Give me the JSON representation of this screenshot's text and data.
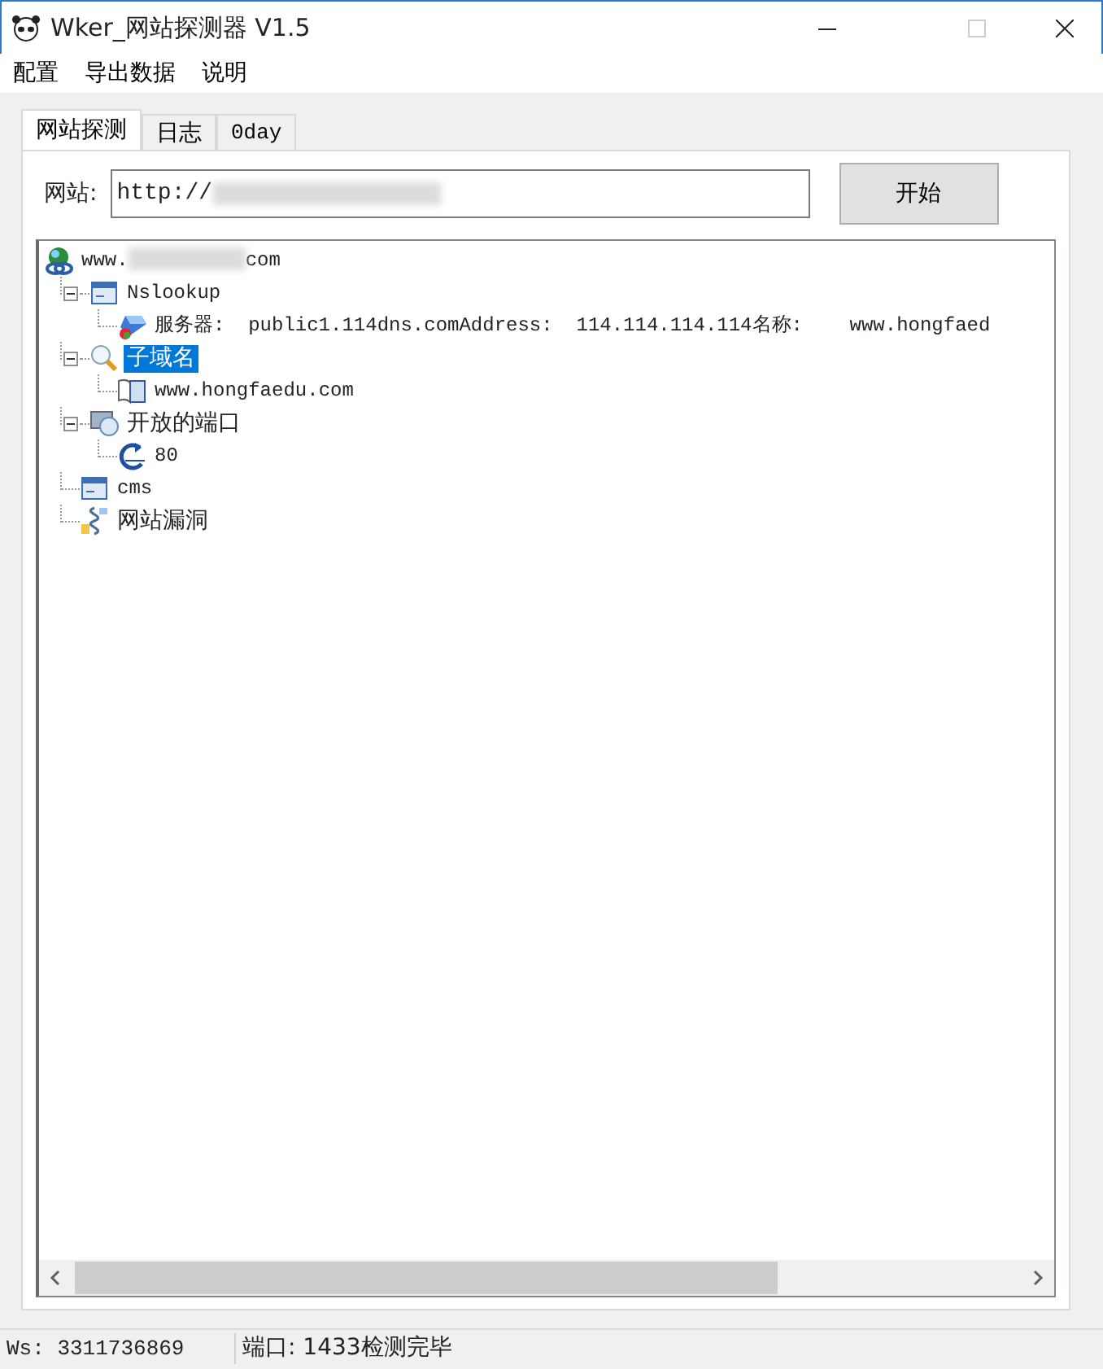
{
  "window": {
    "title": "Wker_网站探测器 V1.5"
  },
  "menu": [
    "配置",
    "导出数据",
    "说明"
  ],
  "tabs": [
    {
      "label": "网站探测",
      "selected": true
    },
    {
      "label": "日志",
      "selected": false
    },
    {
      "label": "0day",
      "selected": false
    }
  ],
  "site_field": {
    "label": "网站:",
    "value": "http://"
  },
  "start_button": "开始",
  "tree": {
    "root": {
      "label_start": "www.",
      "label_end": "com",
      "kind": "host",
      "selected": false,
      "children": [
        {
          "label": "Nslookup",
          "kind": "record",
          "selected": false,
          "expanded": true,
          "children": [
            {
              "label": "服务器:  public1.114dns.comAddress:  114.114.114.114名称:    www.hongfaed",
              "kind": "server",
              "selected": false
            }
          ]
        },
        {
          "label": "子域名",
          "kind": "search",
          "selected": true,
          "expanded": true,
          "children": [
            {
              "label": "www.hongfaedu.com",
              "kind": "domain",
              "selected": false
            }
          ]
        },
        {
          "label": "开放的端口",
          "kind": "ports",
          "selected": false,
          "expanded": true,
          "children": [
            {
              "label": "80",
              "kind": "port",
              "selected": false
            }
          ]
        },
        {
          "label": "cms",
          "kind": "record",
          "selected": false
        },
        {
          "label": "网站漏洞",
          "kind": "vuln",
          "selected": false
        }
      ]
    }
  },
  "status_bar": [
    "Ws: 3311736869",
    "端口: 1433检测完毕"
  ]
}
